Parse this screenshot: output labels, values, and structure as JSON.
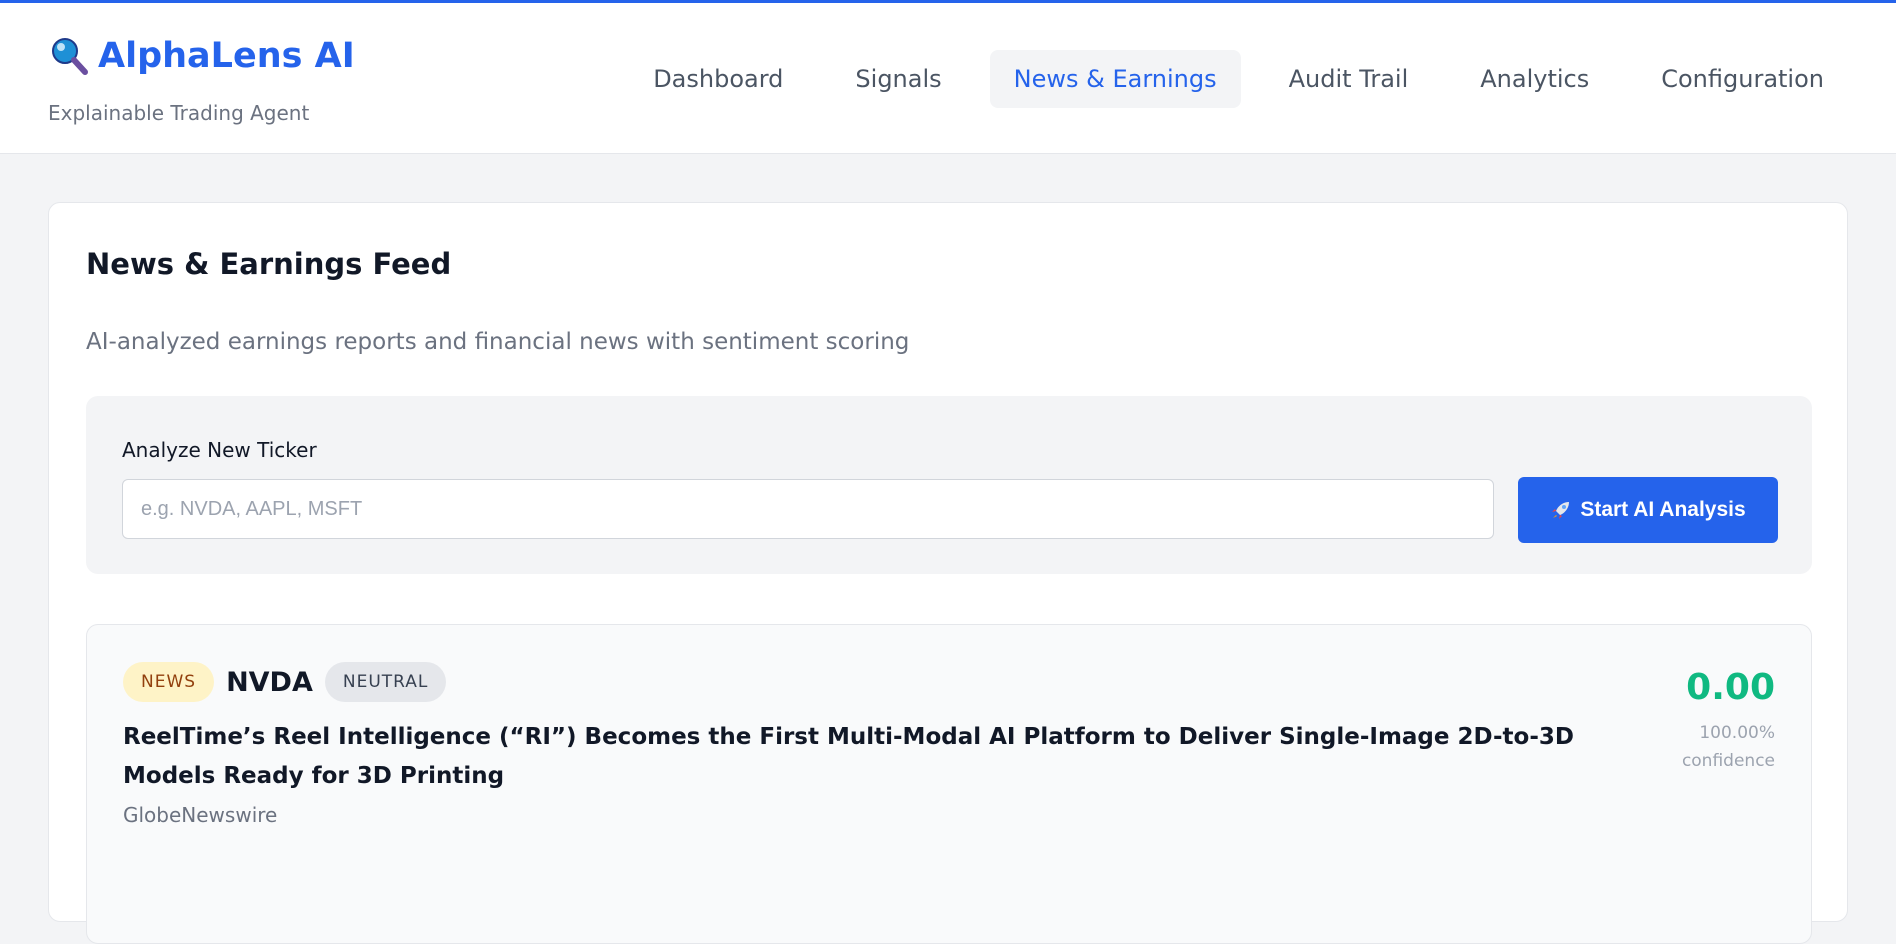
{
  "brand": {
    "title": "AlphaLens AI",
    "subtitle": "Explainable Trading Agent",
    "icon": "magnifier-icon"
  },
  "nav": {
    "items": [
      {
        "label": "Dashboard",
        "active": false
      },
      {
        "label": "Signals",
        "active": false
      },
      {
        "label": "News & Earnings",
        "active": true
      },
      {
        "label": "Audit Trail",
        "active": false
      },
      {
        "label": "Analytics",
        "active": false
      },
      {
        "label": "Configuration",
        "active": false
      }
    ]
  },
  "main": {
    "title": "News & Earnings Feed",
    "subtitle": "AI-analyzed earnings reports and financial news with sentiment scoring",
    "analyze": {
      "label": "Analyze New Ticker",
      "placeholder": "e.g. NVDA, AAPL, MSFT",
      "value": "",
      "button_label": "Start AI Analysis",
      "button_icon": "rocket-icon"
    },
    "feed": [
      {
        "type_badge": "NEWS",
        "ticker": "NVDA",
        "sentiment_badge": "NEUTRAL",
        "headline": "ReelTime’s Reel Intelligence (“RI”) Becomes the First Multi-Modal AI Platform to Deliver Single-Image 2D-to-3D Models Ready for 3D Printing",
        "source": "GlobeNewswire",
        "score": "0.00",
        "confidence_pct": "100.00%",
        "confidence_label": "confidence"
      }
    ]
  },
  "colors": {
    "accent": "#2563eb",
    "positive_score": "#10b981",
    "news_badge_bg": "#fef3c7",
    "neutral_badge_bg": "#e5e7eb"
  }
}
